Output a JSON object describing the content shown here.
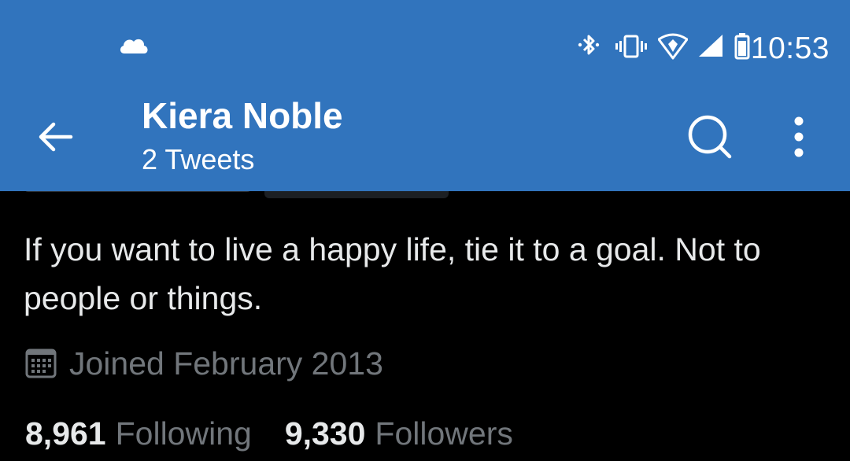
{
  "status_bar": {
    "time": "10:53",
    "left_icons": [
      "cloud-icon"
    ],
    "right_icons": [
      "bluetooth-icon",
      "vibrate-icon",
      "wifi-icon",
      "signal-icon",
      "battery-icon"
    ]
  },
  "header": {
    "title": "Kiera Noble",
    "subtitle": "2 Tweets",
    "background": "#3174bd",
    "icons": [
      "back-arrow-icon",
      "search-icon",
      "more-options-icon"
    ]
  },
  "profile": {
    "bio": "If you want to live a happy life, tie it to a goal. Not to people or things.",
    "joined": "Joined February 2013",
    "following_count": "8,961",
    "following_label": "Following",
    "followers_count": "9,330",
    "followers_label": "Followers"
  },
  "colors": {
    "background": "#000000",
    "primary_text": "#e7e9ea",
    "secondary_text": "#71767b"
  }
}
